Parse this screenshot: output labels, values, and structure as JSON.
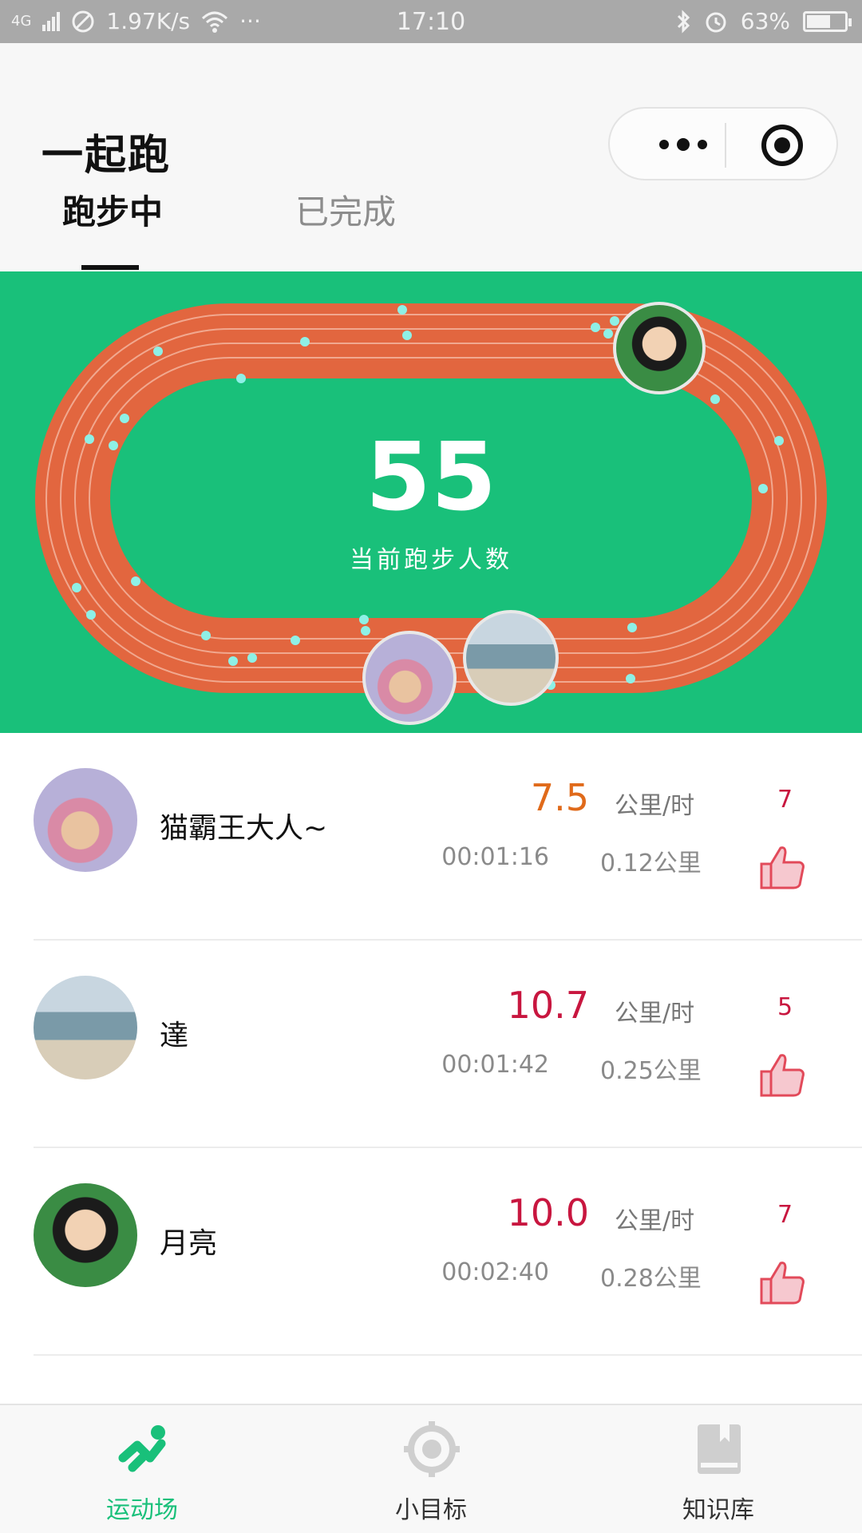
{
  "status_bar": {
    "network": "4G",
    "speed": "1.97K/s",
    "more": "···",
    "time": "17:10",
    "battery_text": "63%",
    "battery_level": 0.63
  },
  "header": {
    "title": "一起跑",
    "tabs": [
      {
        "label": "跑步中",
        "active": true
      },
      {
        "label": "已完成",
        "active": false
      }
    ]
  },
  "track": {
    "count": "55",
    "count_label": "当前跑步人数",
    "colors": {
      "field": "#19c07a",
      "track": "#e2663f",
      "dots": "#8ef0e6"
    }
  },
  "runners": [
    {
      "name": "猫霸王大人~",
      "speed": "7.5",
      "speed_color": "#e06a1a",
      "unit": "公里/时",
      "likes": "7",
      "time": "00:01:16",
      "distance": "0.12公里",
      "avatar": "chopper-avatar"
    },
    {
      "name": "達",
      "speed": "10.7",
      "speed_color": "#c8163f",
      "unit": "公里/时",
      "likes": "5",
      "time": "00:01:42",
      "distance": "0.25公里",
      "avatar": "beach-avatar"
    },
    {
      "name": "月亮",
      "speed": "10.0",
      "speed_color": "#c8163f",
      "unit": "公里/时",
      "likes": "7",
      "time": "00:02:40",
      "distance": "0.28公里",
      "avatar": "boy-avatar"
    }
  ],
  "tabbar": {
    "items": [
      {
        "label": "运动场",
        "active": true,
        "icon": "runner-icon"
      },
      {
        "label": "小目标",
        "active": false,
        "icon": "target-icon"
      },
      {
        "label": "知识库",
        "active": false,
        "icon": "book-icon"
      }
    ],
    "active_color": "#19c07a",
    "inactive_color": "#333333"
  }
}
